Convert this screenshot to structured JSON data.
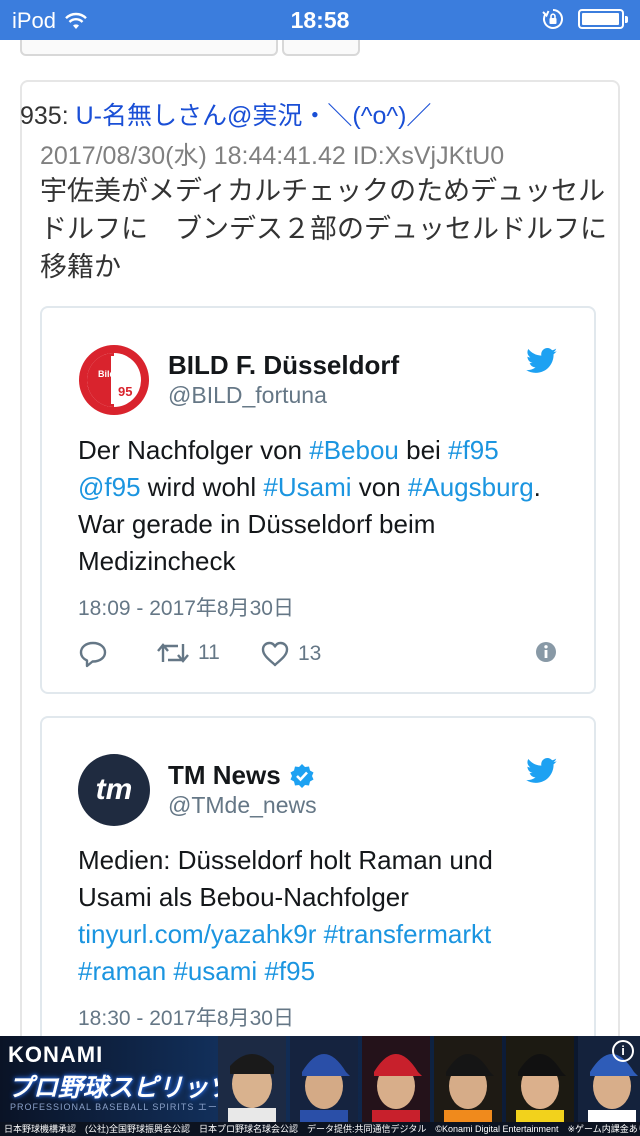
{
  "status_bar": {
    "carrier": "iPod",
    "time": "18:58"
  },
  "post": {
    "number": "935:",
    "name": "U-名無しさん@実況・＼(^o^)／",
    "meta": "2017/08/30(水) 18:44:41.42 ID:XsVjJKtU0",
    "body": "宇佐美がメディカルチェックのためデュッセルドルフに　ブンデス２部のデュッセルドルフに移籍か"
  },
  "tweet1": {
    "name": "BILD F. Düsseldorf",
    "handle": "@BILD_fortuna",
    "avatar_text": "95",
    "text_parts": [
      {
        "t": "Der Nachfolger von ",
        "link": false
      },
      {
        "t": "#Bebou",
        "link": true
      },
      {
        "t": " bei ",
        "link": false
      },
      {
        "t": "#f95",
        "link": true
      },
      {
        "t": " ",
        "link": false
      },
      {
        "t": "@f95",
        "link": true
      },
      {
        "t": " wird wohl ",
        "link": false
      },
      {
        "t": "#Usami",
        "link": true
      },
      {
        "t": " von ",
        "link": false
      },
      {
        "t": "#Augsburg",
        "link": true
      },
      {
        "t": ". War gerade in Düsseldorf beim Medizincheck",
        "link": false
      }
    ],
    "date": "18:09 - 2017年8月30日",
    "retweets": "11",
    "likes": "13"
  },
  "tweet2": {
    "name": "TM News",
    "handle": "@TMde_news",
    "avatar_text": "tm",
    "text_parts": [
      {
        "t": "Medien: Düsseldorf holt Raman und Usami als Bebou-Nachfolger ",
        "link": false
      },
      {
        "t": "tinyurl.com/yazahk9r",
        "link": true
      },
      {
        "t": " ",
        "link": false
      },
      {
        "t": "#transfermarkt",
        "link": true
      },
      {
        "t": " ",
        "link": false
      },
      {
        "t": "#raman",
        "link": true
      },
      {
        "t": " ",
        "link": false
      },
      {
        "t": "#usami",
        "link": true
      },
      {
        "t": " ",
        "link": false
      },
      {
        "t": "#f95",
        "link": true
      }
    ],
    "date": "18:30 - 2017年8月30日"
  },
  "ad": {
    "brand": "KONAMI",
    "title": "プロ野球スピリッツA",
    "subtitle": "PROFESSIONAL BASEBALL SPIRITS エース",
    "footer": "日本野球機構承認　(公社)全国野球振興会公認　日本プロ野球名球会公認　データ提供:共同通信デジタル　©Konami Digital Entertainment　※ゲーム内課金あり",
    "info_icon": "i"
  },
  "colors": {
    "status_bar": "#3b7ddd",
    "link": "#1b95e0",
    "post_name": "#1a4fd6",
    "twitter_blue": "#1da1f2",
    "fortuna_red": "#d9232d",
    "tm_dark": "#1f2b40"
  }
}
